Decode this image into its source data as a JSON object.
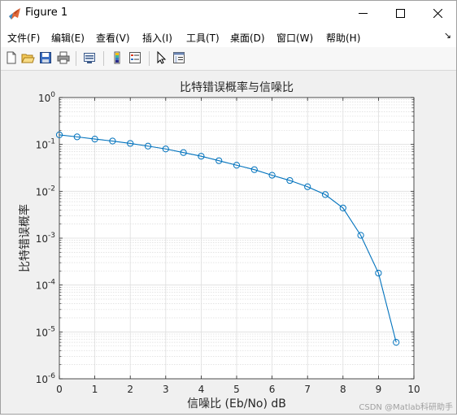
{
  "window": {
    "title": "Figure 1"
  },
  "menubar": {
    "items": [
      "文件(F)",
      "编辑(E)",
      "查看(V)",
      "插入(I)",
      "工具(T)",
      "桌面(D)",
      "窗口(W)",
      "帮助(H)"
    ]
  },
  "toolbar": {
    "buttons": [
      "new-figure-icon",
      "open-icon",
      "save-icon",
      "print-icon",
      "link-plot-icon",
      "insert-colorbar-icon",
      "insert-legend-icon",
      "edit-plot-arrow-icon",
      "property-inspector-icon"
    ]
  },
  "chart_data": {
    "type": "line",
    "title": "比特错误概率与信噪比",
    "xlabel": "信噪比 (Eb/No) dB",
    "ylabel": "比特错误概率",
    "xlim": [
      0,
      10
    ],
    "ylim": [
      1e-06,
      1
    ],
    "yscale": "log",
    "grid": true,
    "x_ticks": [
      "0",
      "1",
      "2",
      "3",
      "4",
      "5",
      "6",
      "7",
      "8",
      "9",
      "10"
    ],
    "y_ticks": [
      {
        "base": "10",
        "exp": "0"
      },
      {
        "base": "10",
        "exp": "-1"
      },
      {
        "base": "10",
        "exp": "-2"
      },
      {
        "base": "10",
        "exp": "-3"
      },
      {
        "base": "10",
        "exp": "-4"
      },
      {
        "base": "10",
        "exp": "-5"
      },
      {
        "base": "10",
        "exp": "-6"
      }
    ],
    "line_color": "#0072BD",
    "marker": "circle",
    "x": [
      0,
      0.5,
      1,
      1.5,
      2,
      2.5,
      3,
      3.5,
      4,
      4.5,
      5,
      5.5,
      6,
      6.5,
      7,
      7.5,
      8,
      8.5,
      9,
      9.5
    ],
    "y": [
      0.16,
      0.145,
      0.13,
      0.118,
      0.105,
      0.092,
      0.08,
      0.067,
      0.056,
      0.045,
      0.036,
      0.029,
      0.022,
      0.017,
      0.0125,
      0.0085,
      0.0044,
      0.00115,
      0.00018,
      6e-06
    ]
  },
  "watermark": "CSDN @Matlab科研助手"
}
